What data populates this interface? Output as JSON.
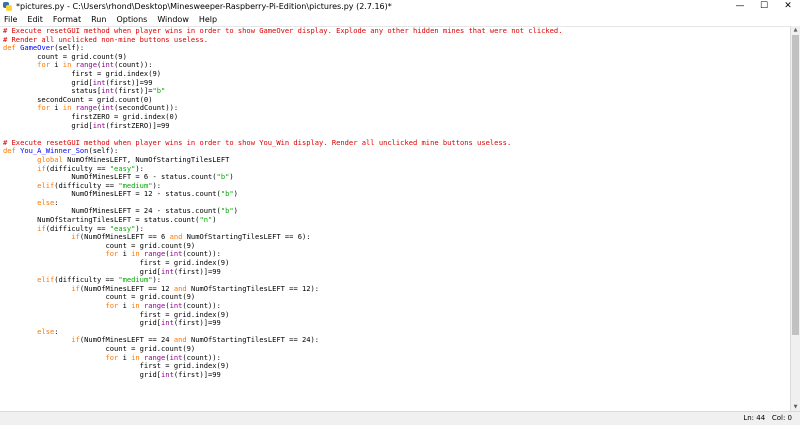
{
  "window": {
    "title": "*pictures.py - C:\\Users\\rhond\\Desktop\\Minesweeper-Raspberry-Pi-Edition\\pictures.py (2.7.16)*",
    "controls": {
      "minimize": "—",
      "maximize": "☐",
      "close": "✕"
    }
  },
  "menu": [
    "File",
    "Edit",
    "Format",
    "Run",
    "Options",
    "Window",
    "Help"
  ],
  "editor": {
    "lines": [
      [
        [
          "c",
          "# Execute resetGUI method when player wins in order to show GameOver display. Explode any other hidden mines that were not clicked."
        ]
      ],
      [
        [
          "c",
          "# Render all unclicked non-mine buttons useless."
        ]
      ],
      [
        [
          "k",
          "def "
        ],
        [
          "d",
          "GameOver"
        ],
        [
          "n",
          "(self):"
        ]
      ],
      [
        [
          "n",
          "        count = grid.count(9)"
        ]
      ],
      [
        [
          "n",
          "        "
        ],
        [
          "k",
          "for"
        ],
        [
          "n",
          " i "
        ],
        [
          "k",
          "in"
        ],
        [
          "n",
          " "
        ],
        [
          "b",
          "range"
        ],
        [
          "n",
          "("
        ],
        [
          "b",
          "int"
        ],
        [
          "n",
          "(count)):"
        ]
      ],
      [
        [
          "n",
          "                first = grid.index(9)"
        ]
      ],
      [
        [
          "n",
          "                grid["
        ],
        [
          "b",
          "int"
        ],
        [
          "n",
          "(first)]=99"
        ]
      ],
      [
        [
          "n",
          "                status["
        ],
        [
          "b",
          "int"
        ],
        [
          "n",
          "(first)]="
        ],
        [
          "s",
          "\"b\""
        ]
      ],
      [
        [
          "n",
          "        secondCount = grid.count(0)"
        ]
      ],
      [
        [
          "n",
          "        "
        ],
        [
          "k",
          "for"
        ],
        [
          "n",
          " i "
        ],
        [
          "k",
          "in"
        ],
        [
          "n",
          " "
        ],
        [
          "b",
          "range"
        ],
        [
          "n",
          "("
        ],
        [
          "b",
          "int"
        ],
        [
          "n",
          "(secondCount)):"
        ]
      ],
      [
        [
          "n",
          "                firstZERO = grid.index(0)"
        ]
      ],
      [
        [
          "n",
          "                grid["
        ],
        [
          "b",
          "int"
        ],
        [
          "n",
          "(firstZERO)]=99"
        ]
      ],
      [
        [
          "n",
          ""
        ]
      ],
      [
        [
          "c",
          "# Execute resetGUI method when player wins in order to show You_Win display. Render all unclicked mine buttons useless."
        ]
      ],
      [
        [
          "k",
          "def "
        ],
        [
          "d",
          "You_A_Winner_Son"
        ],
        [
          "n",
          "(self):"
        ]
      ],
      [
        [
          "n",
          "        "
        ],
        [
          "k",
          "global"
        ],
        [
          "n",
          " NumOfMinesLEFT, NumOfStartingTilesLEFT"
        ]
      ],
      [
        [
          "n",
          "        "
        ],
        [
          "k",
          "if"
        ],
        [
          "n",
          "(difficulty == "
        ],
        [
          "s",
          "\"easy\""
        ],
        [
          "n",
          "):"
        ]
      ],
      [
        [
          "n",
          "                NumOfMinesLEFT = 6 - status.count("
        ],
        [
          "s",
          "\"b\""
        ],
        [
          "n",
          ")"
        ]
      ],
      [
        [
          "n",
          "        "
        ],
        [
          "k",
          "elif"
        ],
        [
          "n",
          "(difficulty == "
        ],
        [
          "s",
          "\"medium\""
        ],
        [
          "n",
          "):"
        ]
      ],
      [
        [
          "n",
          "                NumOfMinesLEFT = 12 - status.count("
        ],
        [
          "s",
          "\"b\""
        ],
        [
          "n",
          ")"
        ]
      ],
      [
        [
          "n",
          "        "
        ],
        [
          "k",
          "else"
        ],
        [
          "n",
          ":"
        ]
      ],
      [
        [
          "n",
          "                NumOfMinesLEFT = 24 - status.count("
        ],
        [
          "s",
          "\"b\""
        ],
        [
          "n",
          ")"
        ]
      ],
      [
        [
          "n",
          "        NumOfStartingTilesLEFT = status.count("
        ],
        [
          "s",
          "\"n\""
        ],
        [
          "n",
          ")"
        ]
      ],
      [
        [
          "n",
          "        "
        ],
        [
          "k",
          "if"
        ],
        [
          "n",
          "(difficulty == "
        ],
        [
          "s",
          "\"easy\""
        ],
        [
          "n",
          "):"
        ]
      ],
      [
        [
          "n",
          "                "
        ],
        [
          "k",
          "if"
        ],
        [
          "n",
          "(NumOfMinesLEFT == 6 "
        ],
        [
          "k",
          "and"
        ],
        [
          "n",
          " NumOfStartingTilesLEFT == 6):"
        ]
      ],
      [
        [
          "n",
          "                        count = grid.count(9)"
        ]
      ],
      [
        [
          "n",
          "                        "
        ],
        [
          "k",
          "for"
        ],
        [
          "n",
          " i "
        ],
        [
          "k",
          "in"
        ],
        [
          "n",
          " "
        ],
        [
          "b",
          "range"
        ],
        [
          "n",
          "("
        ],
        [
          "b",
          "int"
        ],
        [
          "n",
          "(count)):"
        ]
      ],
      [
        [
          "n",
          "                                first = grid.index(9)"
        ]
      ],
      [
        [
          "n",
          "                                grid["
        ],
        [
          "b",
          "int"
        ],
        [
          "n",
          "(first)]=99"
        ]
      ],
      [
        [
          "n",
          "        "
        ],
        [
          "k",
          "elif"
        ],
        [
          "n",
          "(difficulty == "
        ],
        [
          "s",
          "\"medium\""
        ],
        [
          "n",
          "):"
        ]
      ],
      [
        [
          "n",
          "                "
        ],
        [
          "k",
          "if"
        ],
        [
          "n",
          "(NumOfMinesLEFT == 12 "
        ],
        [
          "k",
          "and"
        ],
        [
          "n",
          " NumOfStartingTilesLEFT == 12):"
        ]
      ],
      [
        [
          "n",
          "                        count = grid.count(9)"
        ]
      ],
      [
        [
          "n",
          "                        "
        ],
        [
          "k",
          "for"
        ],
        [
          "n",
          " i "
        ],
        [
          "k",
          "in"
        ],
        [
          "n",
          " "
        ],
        [
          "b",
          "range"
        ],
        [
          "n",
          "("
        ],
        [
          "b",
          "int"
        ],
        [
          "n",
          "(count)):"
        ]
      ],
      [
        [
          "n",
          "                                first = grid.index(9)"
        ]
      ],
      [
        [
          "n",
          "                                grid["
        ],
        [
          "b",
          "int"
        ],
        [
          "n",
          "(first)]=99"
        ]
      ],
      [
        [
          "n",
          "        "
        ],
        [
          "k",
          "else"
        ],
        [
          "n",
          ":"
        ]
      ],
      [
        [
          "n",
          "                "
        ],
        [
          "k",
          "if"
        ],
        [
          "n",
          "(NumOfMinesLEFT == 24 "
        ],
        [
          "k",
          "and"
        ],
        [
          "n",
          " NumOfStartingTilesLEFT == 24):"
        ]
      ],
      [
        [
          "n",
          "                        count = grid.count(9)"
        ]
      ],
      [
        [
          "n",
          "                        "
        ],
        [
          "k",
          "for"
        ],
        [
          "n",
          " i "
        ],
        [
          "k",
          "in"
        ],
        [
          "n",
          " "
        ],
        [
          "b",
          "range"
        ],
        [
          "n",
          "("
        ],
        [
          "b",
          "int"
        ],
        [
          "n",
          "(count)):"
        ]
      ],
      [
        [
          "n",
          "                                first = grid.index(9)"
        ]
      ],
      [
        [
          "n",
          "                                grid["
        ],
        [
          "b",
          "int"
        ],
        [
          "n",
          "(first)]=99"
        ]
      ],
      [
        [
          "n",
          ""
        ]
      ]
    ]
  },
  "status": {
    "text": "Ln: 44   Col: 0"
  },
  "colors": {
    "comment": "#dd0000",
    "keyword": "#ff7700",
    "string": "#00aa00",
    "definition": "#0000ff",
    "builtin": "#900090"
  }
}
